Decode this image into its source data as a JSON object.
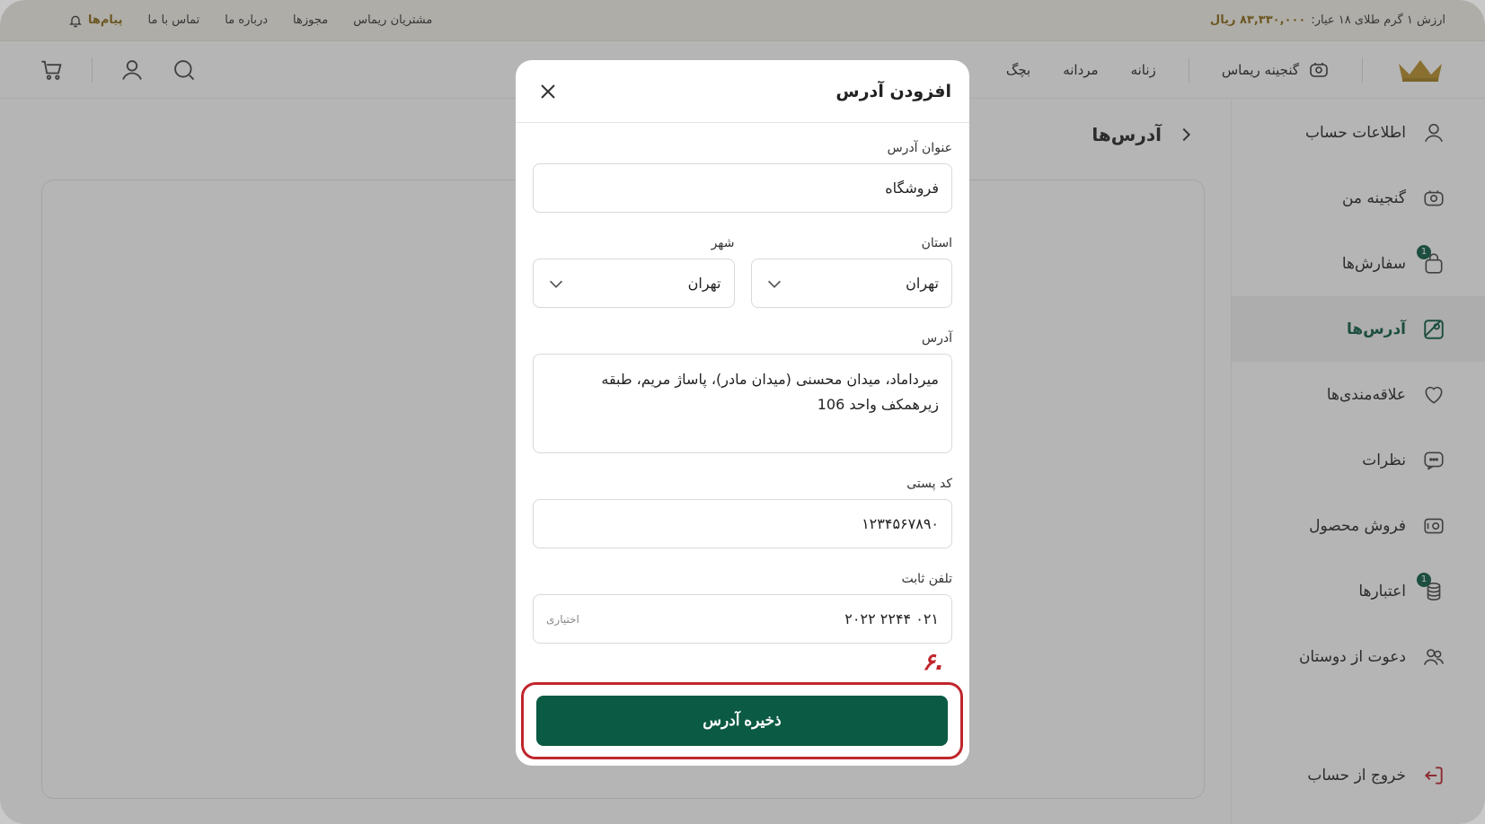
{
  "topbar": {
    "gold_price_label": "ارزش ۱ گرم طلای ۱۸ عیار:",
    "gold_price_value": "۸۳,۳۳۰,۰۰۰ ریال",
    "links": [
      "مشتریان ریماس",
      "مجوزها",
      "درباره ما",
      "تماس با ما"
    ],
    "messages_label": "پیام‌ها"
  },
  "mainnav": {
    "treasury_label": "گنجینه ریماس",
    "items": [
      "زنانه",
      "مردانه",
      "بچگ"
    ]
  },
  "sidebar": {
    "items": [
      {
        "label": "اطلاعات حساب",
        "icon": "user-icon"
      },
      {
        "label": "گنجینه من",
        "icon": "treasury-icon"
      },
      {
        "label": "سفارش‌ها",
        "icon": "bag-icon",
        "badge": "1"
      },
      {
        "label": "آدرس‌ها",
        "icon": "map-icon",
        "active": true
      },
      {
        "label": "علاقه‌مندی‌ها",
        "icon": "heart-icon"
      },
      {
        "label": "نظرات",
        "icon": "comment-icon"
      },
      {
        "label": "فروش محصول",
        "icon": "sell-icon"
      },
      {
        "label": "اعتبارها",
        "icon": "coins-icon",
        "badge": "1"
      },
      {
        "label": "دعوت از دوستان",
        "icon": "users-icon"
      }
    ],
    "logout_label": "خروج از حساب"
  },
  "page": {
    "title": "آدرس‌ها"
  },
  "modal": {
    "title": "افزودن آدرس",
    "address_title_label": "عنوان آدرس",
    "address_title_value": "فروشگاه",
    "province_label": "استان",
    "province_value": "تهران",
    "city_label": "شهر",
    "city_value": "تهران",
    "address_label": "آدرس",
    "address_value": "میرداماد، میدان محسنی (میدان مادر)، پاساژ مریم، طبقه زیرهمکف واحد 106",
    "postal_label": "کد پستی",
    "postal_value": "۱۲۳۴۵۶۷۸۹۰",
    "phone_label": "تلفن ثابت",
    "phone_value": "۰۲۱ ۲۲۴۴ ۲۰۲۲",
    "phone_hint": "اختیاری",
    "save_label": "ذخیره آدرس",
    "step_marker": ".۶"
  },
  "colors": {
    "primary": "#0b5a43",
    "gold": "#8a6a14",
    "highlight": "#c0262d"
  }
}
